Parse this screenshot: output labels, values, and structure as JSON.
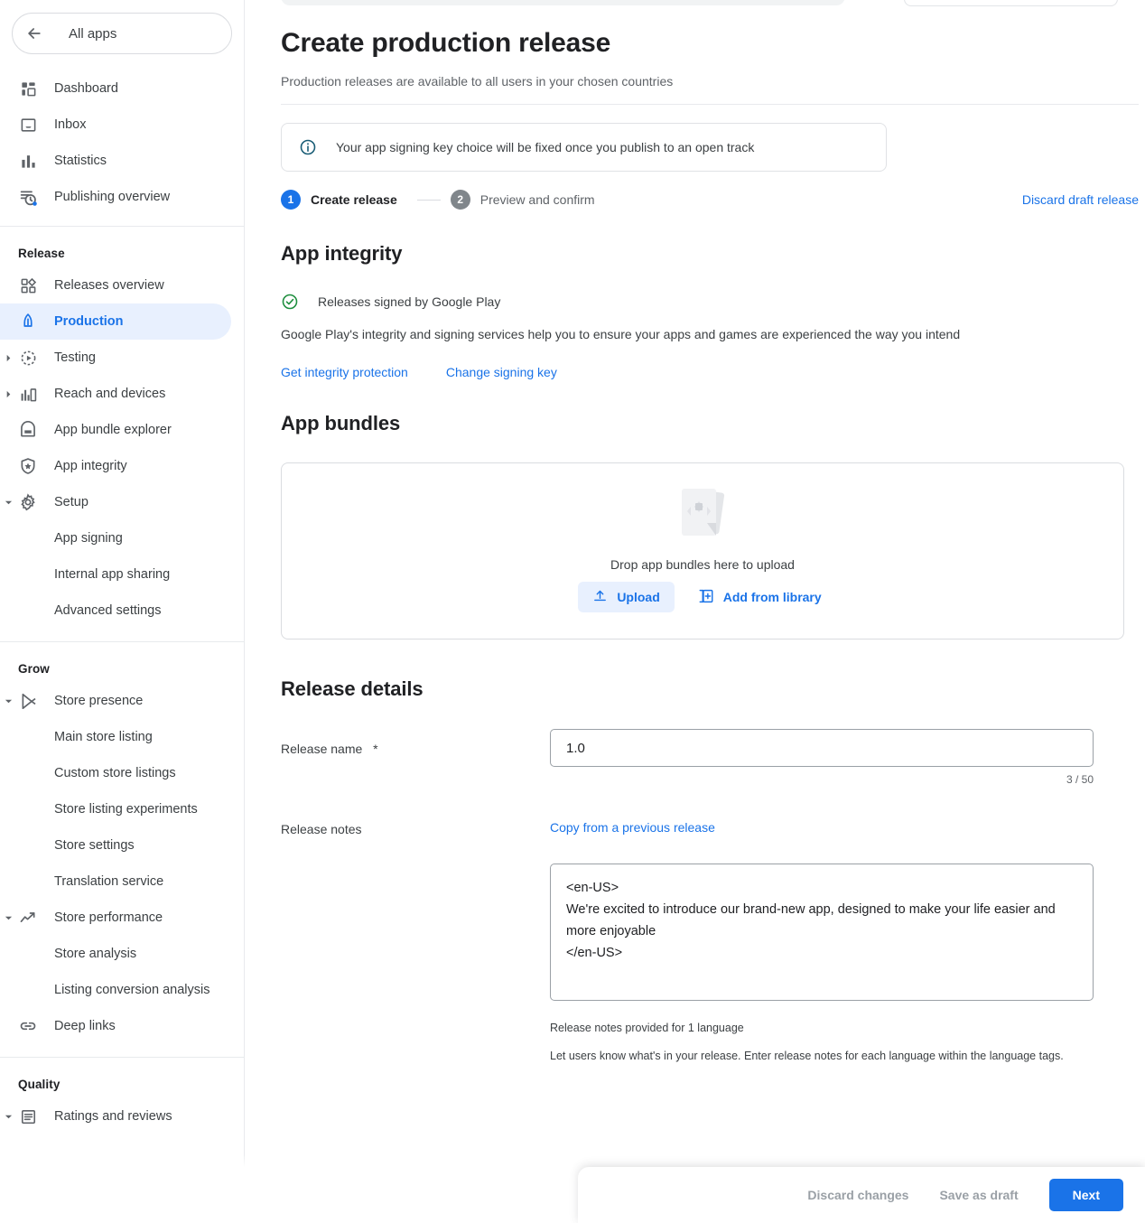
{
  "sidebar": {
    "all_apps": {
      "label": "All apps",
      "icon": "back-arrow-icon"
    },
    "top_items": [
      {
        "label": "Dashboard",
        "icon": "dashboard-icon"
      },
      {
        "label": "Inbox",
        "icon": "inbox-icon"
      },
      {
        "label": "Statistics",
        "icon": "statistics-icon"
      },
      {
        "label": "Publishing overview",
        "icon": "publishing-overview-icon"
      }
    ],
    "release_group": {
      "title": "Release",
      "items": [
        {
          "label": "Releases overview",
          "icon": "releases-overview-icon",
          "expandable": false,
          "active": false
        },
        {
          "label": "Production",
          "icon": "production-rocket-icon",
          "expandable": false,
          "active": true
        },
        {
          "label": "Testing",
          "icon": "testing-icon",
          "expandable": true,
          "expanded": false,
          "active": false
        },
        {
          "label": "Reach and devices",
          "icon": "reach-devices-icon",
          "expandable": true,
          "expanded": false,
          "active": false
        },
        {
          "label": "App bundle explorer",
          "icon": "app-bundle-explorer-icon",
          "expandable": false,
          "active": false
        },
        {
          "label": "App integrity",
          "icon": "app-integrity-shield-icon",
          "expandable": false,
          "active": false
        },
        {
          "label": "Setup",
          "icon": "setup-gear-icon",
          "expandable": true,
          "expanded": true,
          "active": false
        }
      ],
      "sub_items": [
        {
          "label": "App signing"
        },
        {
          "label": "Internal app sharing"
        },
        {
          "label": "Advanced settings"
        }
      ]
    },
    "grow_group": {
      "title": "Grow",
      "store_presence": {
        "label": "Store presence",
        "icon": "play-store-icon",
        "expanded": true
      },
      "store_presence_subs": [
        {
          "label": "Main store listing"
        },
        {
          "label": "Custom store listings"
        },
        {
          "label": "Store listing experiments"
        },
        {
          "label": "Store settings"
        },
        {
          "label": "Translation service"
        }
      ],
      "store_performance": {
        "label": "Store performance",
        "icon": "trending-up-icon",
        "expanded": true
      },
      "store_performance_subs": [
        {
          "label": "Store analysis"
        },
        {
          "label": "Listing conversion analysis"
        }
      ],
      "deep_links": {
        "label": "Deep links",
        "icon": "link-icon"
      }
    },
    "quality_group": {
      "title": "Quality",
      "items": [
        {
          "label": "Ratings and reviews",
          "icon": "ratings-reviews-icon",
          "expandable": true,
          "expanded": true
        }
      ]
    }
  },
  "page": {
    "title": "Create production release",
    "subtitle": "Production releases are available to all users in your chosen countries",
    "banner": {
      "icon": "info-icon",
      "text": "Your app signing key choice will be fixed once you publish to an open track"
    },
    "steps": [
      {
        "number": "1",
        "label": "Create release",
        "state": "current"
      },
      {
        "number": "2",
        "label": "Preview and confirm",
        "state": "upcoming"
      }
    ],
    "discard_draft_label": "Discard draft release"
  },
  "app_integrity": {
    "heading": "App integrity",
    "signed_status": {
      "icon": "check-circle-icon",
      "text": "Releases signed by Google Play"
    },
    "description": "Google Play's integrity and signing services help you to ensure your apps and games are experienced the way you intend",
    "links": [
      {
        "label": "Get integrity protection"
      },
      {
        "label": "Change signing key"
      }
    ]
  },
  "app_bundles": {
    "heading": "App bundles",
    "drop_text": "Drop app bundles here to upload",
    "upload_label": "Upload",
    "upload_icon": "upload-icon",
    "add_from_library_label": "Add from library",
    "add_from_library_icon": "add-from-library-icon"
  },
  "release_details": {
    "heading": "Release details",
    "release_name_label": "Release name",
    "release_name_required_marker": "*",
    "release_name_value": "1.0",
    "release_name_placeholder": "",
    "char_count": "3 / 50",
    "release_notes_label": "Release notes",
    "copy_previous_label": "Copy from a previous release",
    "release_notes_value": "<en-US>\nWe're excited to introduce our brand-new app, designed to make your life easier and more enjoyable\n</en-US>",
    "release_notes_placeholder": "",
    "notes_meta_1": "Release notes provided for 1 language",
    "notes_meta_2": "Let users know what's in your release. Enter release notes for each language within the language tags."
  },
  "action_bar": {
    "discard_changes_label": "Discard changes",
    "save_draft_label": "Save as draft",
    "next_label": "Next"
  },
  "colors": {
    "accent_blue": "#1a73e8",
    "active_nav_bg": "#e8f0fe",
    "success_green": "#1e8e3e",
    "info_icon": "#185c75",
    "muted_gray": "#5f6368",
    "step_inactive": "#80868b"
  }
}
